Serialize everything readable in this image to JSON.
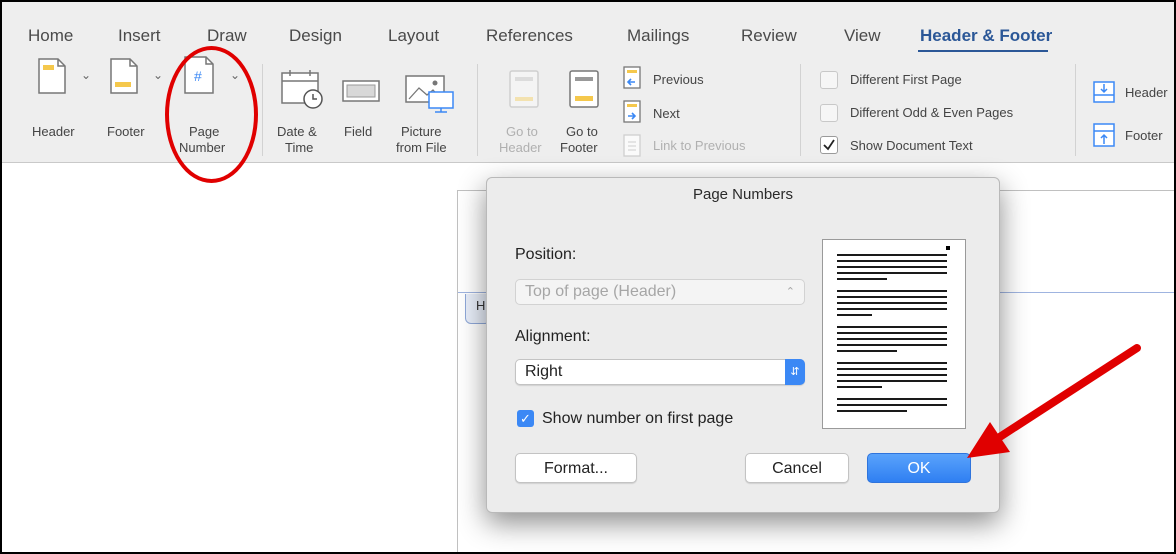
{
  "tabs": {
    "home": "Home",
    "insert": "Insert",
    "draw": "Draw",
    "design": "Design",
    "layout": "Layout",
    "references": "References",
    "mailings": "Mailings",
    "review": "Review",
    "view": "View",
    "header_footer": "Header & Footer"
  },
  "ribbon": {
    "header": "Header",
    "footer": "Footer",
    "page_number_1": "Page",
    "page_number_2": "Number",
    "date_time_1": "Date &",
    "date_time_2": "Time",
    "field": "Field",
    "picture_1": "Picture",
    "picture_2": "from File",
    "goto_header_1": "Go to",
    "goto_header_2": "Header",
    "goto_footer_1": "Go to",
    "goto_footer_2": "Footer",
    "previous": "Previous",
    "next": "Next",
    "link_previous": "Link to Previous",
    "different_first_page": "Different First Page",
    "different_odd_even": "Different Odd & Even Pages",
    "show_document_text": "Show Document Text",
    "header_position": "Header",
    "footer_position": "Footer"
  },
  "document": {
    "header_tab": "H"
  },
  "dialog": {
    "title": "Page Numbers",
    "position_label": "Position:",
    "position_value": "Top of page (Header)",
    "alignment_label": "Alignment:",
    "alignment_value": "Right",
    "show_first_page_label": "Show number on first page",
    "show_first_page_checked": true,
    "format_button": "Format...",
    "cancel_button": "Cancel",
    "ok_button": "OK"
  },
  "colors": {
    "accent_blue": "#3b88f5",
    "active_tab": "#2b5797",
    "annotation_red": "#e00000"
  }
}
